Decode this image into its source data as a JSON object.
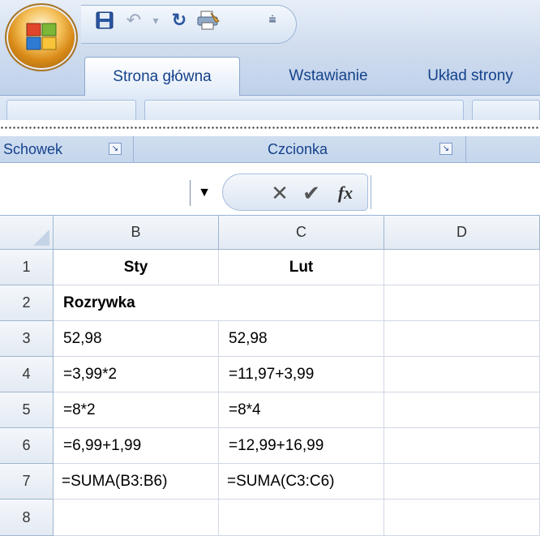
{
  "qat": {
    "save_icon": "floppy-disk-icon",
    "undo_icon": "undo-icon",
    "redo_icon": "redo-icon",
    "quickprint_icon": "quick-print-icon",
    "customize_icon": "customize-qat-icon"
  },
  "tabs": [
    {
      "label": "Strona główna",
      "active": true
    },
    {
      "label": "Wstawianie",
      "active": false
    },
    {
      "label": "Układ strony",
      "active": false
    }
  ],
  "ribbon": {
    "groups": [
      {
        "label": "Schowek"
      },
      {
        "label": "Czcionka"
      }
    ]
  },
  "formula_bar": {
    "name_box_value": "",
    "cancel_glyph": "✕",
    "enter_glyph": "✔",
    "fx_glyph": "fx",
    "content": ""
  },
  "grid": {
    "columns": [
      "B",
      "C",
      "D"
    ],
    "rows": [
      {
        "num": "1",
        "cells": [
          "Sty",
          "Lut",
          ""
        ]
      },
      {
        "num": "2",
        "cells": [
          "Rozrywka",
          "",
          ""
        ]
      },
      {
        "num": "3",
        "cells": [
          "52,98",
          "52,98",
          ""
        ]
      },
      {
        "num": "4",
        "cells": [
          "=3,99*2",
          "=11,97+3,99",
          ""
        ]
      },
      {
        "num": "5",
        "cells": [
          "=8*2",
          "=8*4",
          ""
        ]
      },
      {
        "num": "6",
        "cells": [
          "=6,99+1,99",
          "=12,99+16,99",
          ""
        ]
      },
      {
        "num": "7",
        "cells": [
          "=SUMA(B3:B6)",
          "=SUMA(C3:C6)",
          ""
        ]
      },
      {
        "num": "8",
        "cells": [
          "",
          "",
          ""
        ]
      }
    ]
  },
  "colors": {
    "ribbon_text": "#15428b",
    "header_border": "#9eb6ce",
    "grid_line": "#d0d7e5"
  }
}
